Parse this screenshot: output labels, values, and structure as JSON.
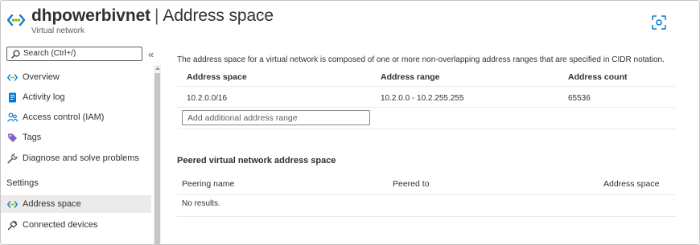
{
  "header": {
    "resource_name": "dhpowerbivnet",
    "separator": "|",
    "section": "Address space",
    "more": "···",
    "subtitle": "Virtual network"
  },
  "sidebar": {
    "search_placeholder": "Search (Ctrl+/)",
    "collapse": "«",
    "items": [
      {
        "label": "Overview",
        "icon": "virtual-network-icon"
      },
      {
        "label": "Activity log",
        "icon": "activity-log-icon"
      },
      {
        "label": "Access control (IAM)",
        "icon": "people-icon"
      },
      {
        "label": "Tags",
        "icon": "tag-icon"
      },
      {
        "label": "Diagnose and solve problems",
        "icon": "wrench-icon"
      }
    ],
    "settings_header": "Settings",
    "settings_items": [
      {
        "label": "Address space",
        "icon": "virtual-network-icon",
        "active": true
      },
      {
        "label": "Connected devices",
        "icon": "plug-icon"
      }
    ]
  },
  "main": {
    "description": "The address space for a virtual network is composed of one or more non-overlapping address ranges that are specified in CIDR notation.",
    "address_table": {
      "columns": [
        "Address space",
        "Address range",
        "Address count"
      ],
      "rows": [
        [
          "10.2.0.0/16",
          "10.2.0.0 - 10.2.255.255",
          "65536"
        ]
      ]
    },
    "add_placeholder": "Add additional address range",
    "peered_title": "Peered virtual network address space",
    "peered_table": {
      "columns": [
        "Peering name",
        "Peered to",
        "Address space"
      ],
      "empty_text": "No results."
    }
  },
  "colors": {
    "accent": "#0078d4",
    "vnet_green": "#7fba00",
    "text": "#323130",
    "selected_bg": "#edebe9"
  }
}
